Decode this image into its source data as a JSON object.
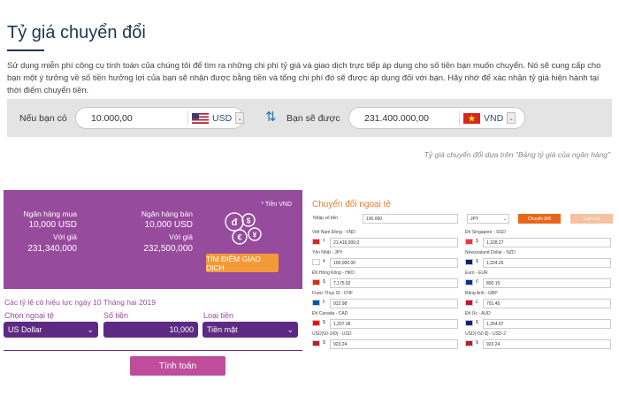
{
  "page": {
    "title": "Tỷ giá chuyển đổi",
    "description": "Sử dụng miễn phí công cụ tính toán của chúng tôi để tìm ra những chi phí tỷ giá và giao dịch trực tiếp áp dụng cho số tiền bạn muốn chuyển. Nó sẽ cung cấp cho bạn một ý tưởng về số tiền hưởng lợi của bạn sẽ nhận được bằng tiền và tổng chi phí đó sẽ được áp dụng đối với bạn. Hãy nhớ để xác nhận tỷ giá hiện hành tại thời điểm chuyển tiền."
  },
  "converter": {
    "from_label": "Nếu bạn có",
    "from_amount": "10.000,00",
    "from_currency": "USD",
    "to_label": "Bạn sẽ được",
    "to_amount": "231.400.000,00",
    "to_currency": "VND",
    "dropdown_glyph": "⌄",
    "swap_icon": "⇅"
  },
  "note": "Tỷ giá chuyển đổi dựa trên \"Bảng tỷ giá của ngân hàng\"",
  "panel": {
    "unit": "* Tiền VND",
    "buy_title": "Ngân hàng mua",
    "buy_amount": "10,000 USD",
    "buy_rate_label": "Với giá",
    "buy_value": "231,340,000",
    "sell_title": "Ngân hàng bán",
    "sell_amount": "10,000 USD",
    "sell_rate_label": "Với giá",
    "sell_value": "232,500,000",
    "find_button": "TÌM ĐIỂM GIAO DỊCH",
    "coin_glyphs": [
      "đ",
      "$",
      "€",
      "¥"
    ]
  },
  "form": {
    "date_text": "Các tỷ lệ có hiệu lực ngày 10 Tháng hai 2019",
    "currency_label": "Chọn ngoại tệ",
    "currency_value": "US Dollar",
    "amount_label": "Số tiền",
    "amount_value": "10,000",
    "type_label": "Loại tiền",
    "type_value": "Tiền mặt",
    "calc_button": "Tính toán",
    "chevron": "⌄"
  },
  "sheet": {
    "title": "Chuyển đổi ngoại tệ",
    "input_label": "Nhập số tiền",
    "input_value": "100.000",
    "select_value": "JPY",
    "select_arrow": "⌄",
    "convert_button": "Chuyển Đổi",
    "reset_button": "Làm Lại",
    "rows": [
      {
        "label": "Việt Nam Đồng - VND",
        "symbol": "₫",
        "value": "21,416,000.0",
        "color": "#da251d"
      },
      {
        "label": "Đô Singapore - SGD",
        "symbol": "$",
        "value": "1,328.27",
        "color": "#ef3340"
      },
      {
        "label": "Yên Nhật - JPY",
        "symbol": "¥",
        "value": "100,000.00",
        "color": "#ffffff"
      },
      {
        "label": "Newzealand Dollar - NZD",
        "symbol": "$",
        "value": "1,324.26",
        "color": "#012169"
      },
      {
        "label": "Đô Hồng Kông - HKD",
        "symbol": "$",
        "value": "7,175.92",
        "color": "#de2910"
      },
      {
        "label": "Euro - EUR",
        "symbol": "€",
        "value": "800.15",
        "color": "#003399"
      },
      {
        "label": "Franc Thụy Sĩ - CHF",
        "symbol": "₣",
        "value": "912.98",
        "color": "#0055a4"
      },
      {
        "label": "Bảng Anh - GBP",
        "symbol": "£",
        "value": "701.45",
        "color": "#c8102e"
      },
      {
        "label": "Đô Canada - CAD",
        "symbol": "$",
        "value": "1,207.36",
        "color": "#ff0000"
      },
      {
        "label": "Đô Úc - AUD",
        "symbol": "$",
        "value": "1,354.07",
        "color": "#00247d"
      },
      {
        "label": "USD(50-100) - USD",
        "symbol": "$",
        "value": "923.24",
        "color": "#b22234"
      },
      {
        "label": "USD(<50 $) - USD-2",
        "symbol": "$",
        "value": "923.24",
        "color": "#b22234"
      }
    ]
  }
}
